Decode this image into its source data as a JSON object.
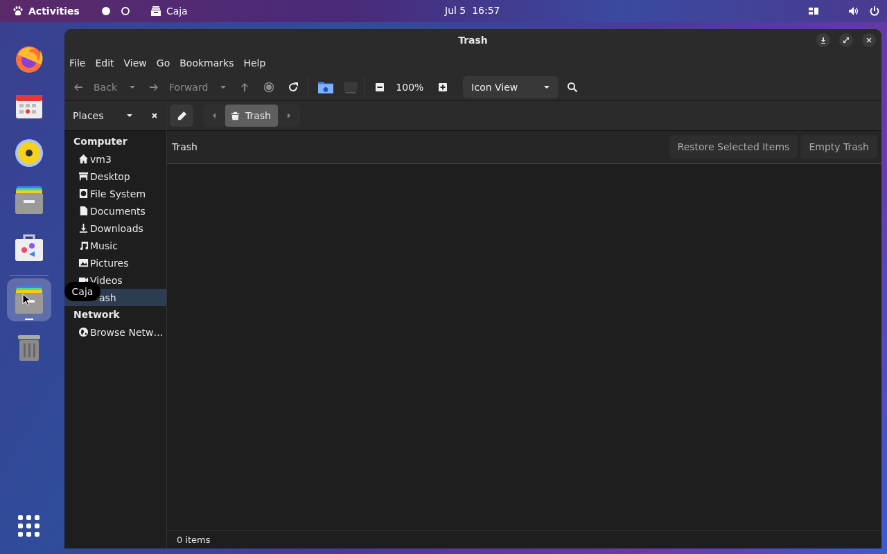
{
  "topbar": {
    "activities": "Activities",
    "workspaces": [
      {
        "selected": true
      },
      {
        "selected": false
      }
    ],
    "app": "Caja",
    "clock": "Jul 5  16:57"
  },
  "dock": {
    "items": [
      {
        "kind": "browser",
        "selected": false
      },
      {
        "kind": "calendar",
        "selected": false
      },
      {
        "kind": "speaker",
        "selected": false
      },
      {
        "kind": "drawer",
        "selected": false
      },
      {
        "kind": "bag",
        "selected": false
      },
      {
        "kind": "drawer",
        "selected": true
      },
      {
        "kind": "trash",
        "selected": false
      }
    ],
    "tooltip": "Caja"
  },
  "window": {
    "title": "Trash"
  },
  "menu": [
    "File",
    "Edit",
    "View",
    "Go",
    "Bookmarks",
    "Help"
  ],
  "toolbar": {
    "back": {
      "label": "Back",
      "disabled": true
    },
    "forward": {
      "label": "Forward",
      "disabled": true
    },
    "up": {
      "disabled": true
    },
    "stop": {
      "disabled": true
    },
    "reload": {
      "disabled": false
    },
    "zoom": "100%",
    "view": "Icon View"
  },
  "sidebar": {
    "title": "Places",
    "sections": [
      {
        "heading": "Computer",
        "items": [
          {
            "kind": "home",
            "label": "vm3",
            "selected": false
          },
          {
            "kind": "desktop",
            "label": "Desktop",
            "selected": false
          },
          {
            "kind": "drive",
            "label": "File System",
            "selected": false
          },
          {
            "kind": "document",
            "label": "Documents",
            "selected": false
          },
          {
            "kind": "download",
            "label": "Downloads",
            "selected": false
          },
          {
            "kind": "music",
            "label": "Music",
            "selected": false
          },
          {
            "kind": "pictures",
            "label": "Pictures",
            "selected": false
          },
          {
            "kind": "video",
            "label": "Videos",
            "selected": false
          },
          {
            "kind": "covered",
            "label": "ash",
            "selected": true
          }
        ]
      },
      {
        "heading": "Network",
        "items": [
          {
            "kind": "globe",
            "label": "Browse Netw…",
            "selected": false
          }
        ]
      }
    ]
  },
  "location": {
    "crumbs": [
      {
        "label": "Trash",
        "selected": true
      }
    ]
  },
  "infobar": {
    "title": "Trash",
    "buttons": [
      "Restore Selected Items",
      "Empty Trash"
    ]
  },
  "status": "0 items"
}
